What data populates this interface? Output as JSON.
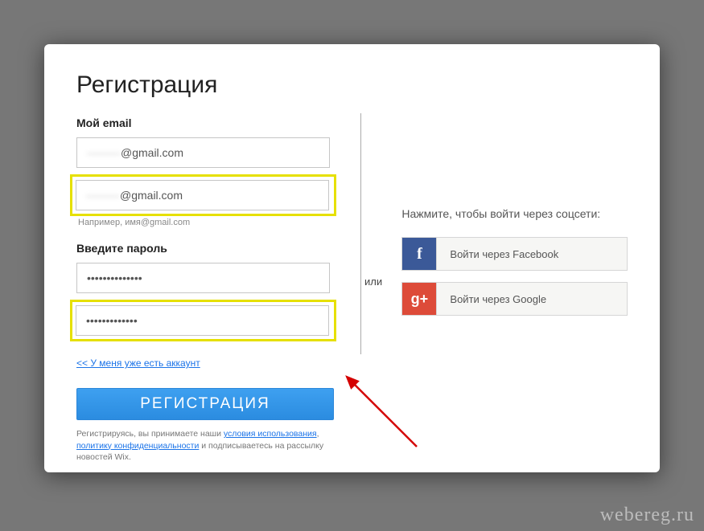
{
  "title": "Регистрация",
  "email": {
    "label": "Мой email",
    "value_blur": "———",
    "value_suffix": "@gmail.com",
    "confirm_value_blur": "———",
    "confirm_value_suffix": "@gmail.com",
    "hint": "Например, имя@gmail.com"
  },
  "password": {
    "label": "Введите пароль",
    "value": "••••••••••••••",
    "confirm_value": "•••••••••••••"
  },
  "divider_label": "или",
  "login_link": "<< У меня уже есть аккаунт",
  "submit_label": "РЕГИСТРАЦИЯ",
  "terms": {
    "prefix": "Регистрируясь, вы принимаете наши ",
    "tos": "условия использования",
    "sep": ", ",
    "privacy": "политику конфиденциальности",
    "suffix": " и подписываетесь на рассылку новостей Wix."
  },
  "social": {
    "hint": "Нажмите, чтобы войти через соцсети:",
    "facebook_label": "Войти через Facebook",
    "google_label": "Войти через Google"
  },
  "watermark": "webereg.ru"
}
